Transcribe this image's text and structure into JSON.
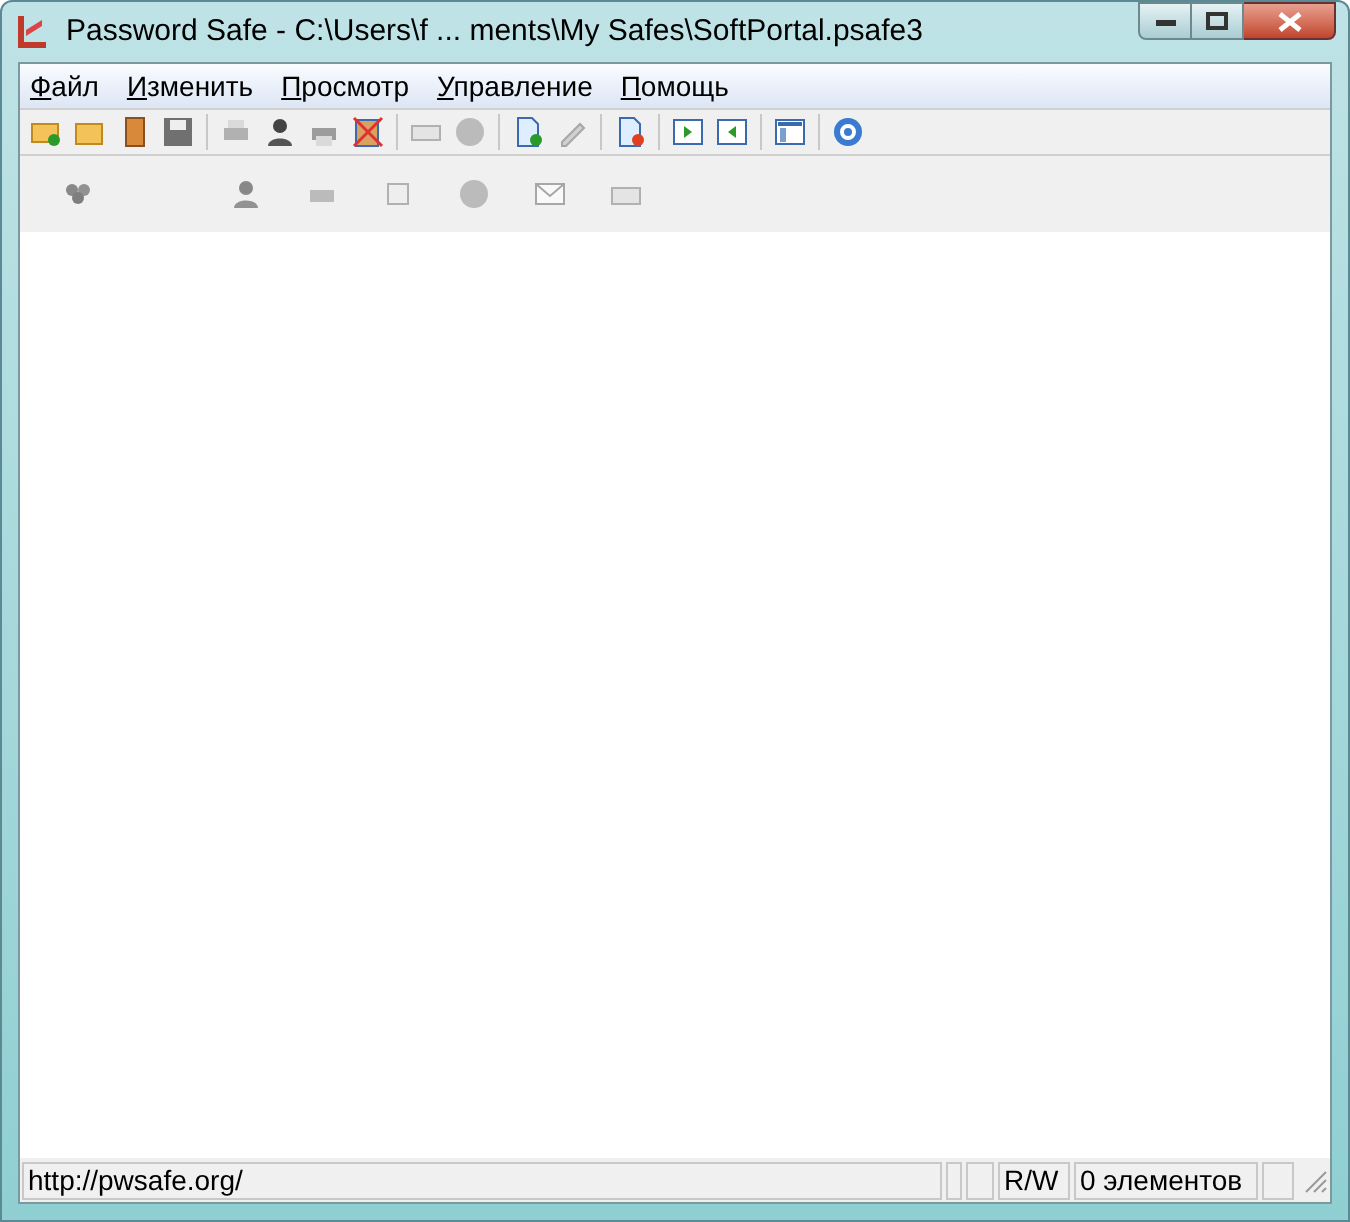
{
  "window": {
    "title": "Password Safe - C:\\Users\\f ... ments\\My Safes\\SoftPortal.psafe3"
  },
  "menu": [
    {
      "label": "Файл"
    },
    {
      "label": "Изменить"
    },
    {
      "label": "Просмотр"
    },
    {
      "label": "Управление"
    },
    {
      "label": "Помощь"
    }
  ],
  "status_bar": {
    "url": "http://pwsafe.org/",
    "mode": "R/W",
    "count": "0 элементов"
  }
}
